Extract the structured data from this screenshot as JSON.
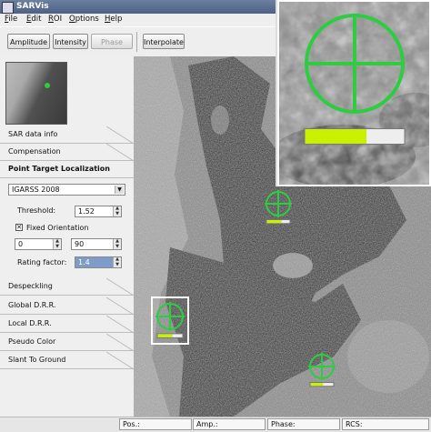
{
  "window": {
    "title": "SARVis"
  },
  "menu": [
    {
      "mnemonic": "F",
      "rest": "ile"
    },
    {
      "mnemonic": "E",
      "rest": "dit"
    },
    {
      "mnemonic": "R",
      "rest": "OI"
    },
    {
      "mnemonic": "O",
      "rest": "ptions"
    },
    {
      "mnemonic": "H",
      "rest": "elp"
    }
  ],
  "toolbar": {
    "amplitude": "Amplitude",
    "intensity": "Intensity",
    "phase": "Phase",
    "interpolate": "Interpolate"
  },
  "sections": {
    "sar_data_info": "SAR data info",
    "compensation": "Compensation",
    "point_target": "Point Target Localization",
    "despeckling": "Despeckling",
    "global_drr": "Global D.R.R.",
    "local_drr": "Local D.R.R.",
    "pseudo_color": "Pseudo Color",
    "slant_to_ground": "Slant To Ground"
  },
  "ptl": {
    "method": "IGARSS 2008",
    "threshold_label": "Threshold:",
    "threshold_value": "1.52",
    "fixed_orientation_label": "Fixed Orientation",
    "fixed_orientation_checked": true,
    "orientation_min": "0",
    "orientation_max": "90",
    "rating_label": "Rating factor:",
    "rating_value": "1.4"
  },
  "targets": [
    {
      "rating": 0.65,
      "color": "#2ecc40",
      "bar_color": "#c8f000"
    },
    {
      "rating": 0.6,
      "color": "#2ecc40",
      "bar_color": "#c8f000"
    },
    {
      "rating": 0.55,
      "color": "#2ecc40",
      "bar_color": "#c8f000"
    },
    {
      "rating": 0.62,
      "color": "#2ecc40",
      "bar_color": "#c8f000"
    }
  ],
  "status": {
    "pos": "Pos.:",
    "amp": "Amp.:",
    "phase": "Phase:",
    "rcs": "RCS:"
  },
  "colors": {
    "target_green": "#2ecc40",
    "rating_bar": "#c8f000",
    "selection": "#7f9bc7"
  }
}
